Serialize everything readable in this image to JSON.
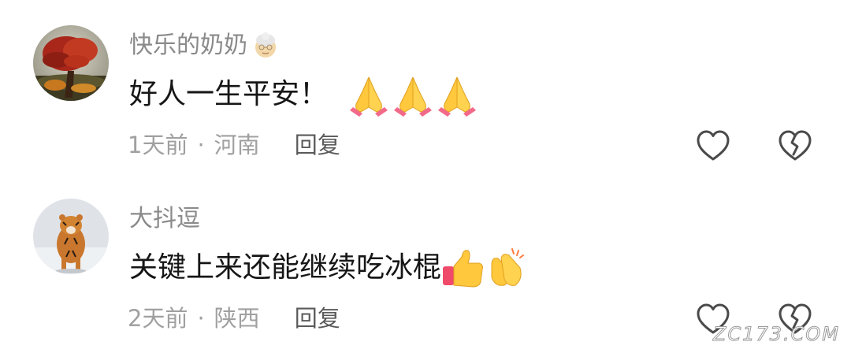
{
  "comments": [
    {
      "username": "快乐的奶奶",
      "username_badge": "grandma-emoji",
      "text": "好人一生平安！",
      "emojis": [
        "folded-hands",
        "folded-hands",
        "folded-hands"
      ],
      "time": "1天前",
      "separator": "·",
      "location": "河南",
      "reply_label": "回复"
    },
    {
      "username": "大抖逗",
      "text": "关键上来还能继续吃冰棍",
      "emojis": [
        "thumbs-up",
        "clapping-hands"
      ],
      "time": "2天前",
      "separator": "·",
      "location": "陕西",
      "reply_label": "回复"
    }
  ],
  "icons": {
    "like": "heart-outline-icon",
    "dislike": "broken-heart-outline-icon"
  },
  "watermark": "ZC173.COM",
  "colors": {
    "username": "#8a8a8a",
    "text": "#161616",
    "meta": "#a0a0a0",
    "reply": "#5a5a5a",
    "icon_stroke": "#4a4a4a"
  }
}
